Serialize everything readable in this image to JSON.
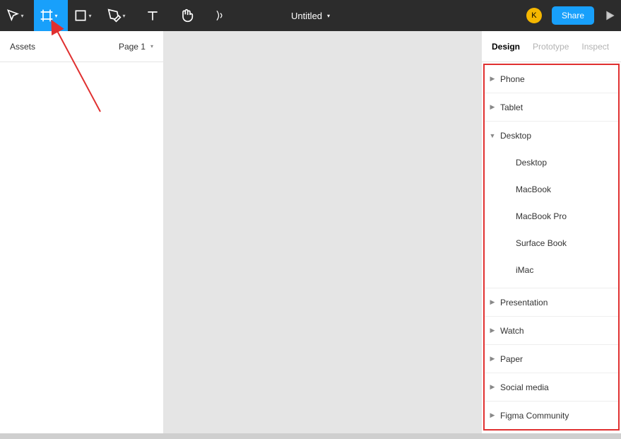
{
  "toolbar": {
    "doc_title": "Untitled",
    "share_label": "Share",
    "avatar_letter": "K"
  },
  "left_panel": {
    "assets_tab": "Assets",
    "page_label": "Page 1"
  },
  "right_panel": {
    "tabs": {
      "design": "Design",
      "prototype": "Prototype",
      "inspect": "Inspect"
    }
  },
  "frame_presets": [
    {
      "label": "Phone",
      "expanded": false,
      "children": []
    },
    {
      "label": "Tablet",
      "expanded": false,
      "children": []
    },
    {
      "label": "Desktop",
      "expanded": true,
      "children": [
        {
          "label": "Desktop"
        },
        {
          "label": "MacBook"
        },
        {
          "label": "MacBook Pro"
        },
        {
          "label": "Surface Book"
        },
        {
          "label": "iMac"
        }
      ]
    },
    {
      "label": "Presentation",
      "expanded": false,
      "children": []
    },
    {
      "label": "Watch",
      "expanded": false,
      "children": []
    },
    {
      "label": "Paper",
      "expanded": false,
      "children": []
    },
    {
      "label": "Social media",
      "expanded": false,
      "children": []
    },
    {
      "label": "Figma Community",
      "expanded": false,
      "children": []
    }
  ]
}
